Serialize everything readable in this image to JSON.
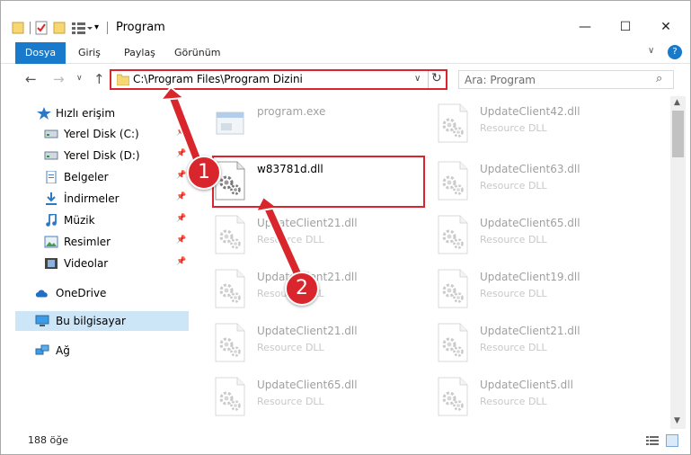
{
  "window": {
    "title": "Program",
    "minimize_glyph": "—",
    "maximize_glyph": "☐",
    "close_glyph": "✕"
  },
  "ribbon": {
    "tabs": [
      "Dosya",
      "Giriş",
      "Paylaş",
      "Görünüm"
    ],
    "active_tab": "Dosya",
    "help_glyph": "?"
  },
  "address": {
    "path": "C:\\Program Files\\Program Dizini",
    "search_placeholder": "Ara: Program"
  },
  "nav_pane": {
    "quick_access": "Hızlı erişim",
    "quick_items": [
      {
        "label": "Yerel Disk (C:)",
        "icon": "drive-icon",
        "pinned": true
      },
      {
        "label": "Yerel Disk (D:)",
        "icon": "drive-icon",
        "pinned": true
      },
      {
        "label": "Belgeler",
        "icon": "documents-icon",
        "pinned": true
      },
      {
        "label": "İndirmeler",
        "icon": "downloads-icon",
        "pinned": true
      },
      {
        "label": "Müzik",
        "icon": "music-icon",
        "pinned": true
      },
      {
        "label": "Resimler",
        "icon": "pictures-icon",
        "pinned": true
      },
      {
        "label": "Videolar",
        "icon": "videos-icon",
        "pinned": true
      }
    ],
    "onedrive": "OneDrive",
    "this_pc": "Bu bilgisayar",
    "network": "Ağ"
  },
  "files": {
    "left_column": [
      {
        "name": "program.exe",
        "type": "",
        "faded": true,
        "highlighted": false,
        "icon": "exe-icon"
      },
      {
        "name": "w83781d.dll",
        "type": "",
        "faded": false,
        "highlighted": true,
        "icon": "dll-gear-icon"
      },
      {
        "name": "UpdateClient21.dll",
        "type": "Resource DLL",
        "faded": true,
        "highlighted": false,
        "icon": "dll-gear-icon"
      },
      {
        "name": "UpdateClient21.dll",
        "type": "Resource DLL",
        "faded": true,
        "highlighted": false,
        "icon": "dll-gear-icon"
      },
      {
        "name": "UpdateClient21.dll",
        "type": "Resource DLL",
        "faded": true,
        "highlighted": false,
        "icon": "dll-gear-icon"
      },
      {
        "name": "UpdateClient65.dll",
        "type": "Resource DLL",
        "faded": true,
        "highlighted": false,
        "icon": "dll-gear-icon"
      }
    ],
    "right_column": [
      {
        "name": "UpdateClient42.dll",
        "type": "Resource DLL",
        "faded": true,
        "icon": "dll-gear-icon"
      },
      {
        "name": "UpdateClient63.dll",
        "type": "Resource DLL",
        "faded": true,
        "icon": "dll-gear-icon"
      },
      {
        "name": "UpdateClient65.dll",
        "type": "Resource DLL",
        "faded": true,
        "icon": "dll-gear-icon"
      },
      {
        "name": "UpdateClient19.dll",
        "type": "Resource DLL",
        "faded": true,
        "icon": "dll-gear-icon"
      },
      {
        "name": "UpdateClient21.dll",
        "type": "Resource DLL",
        "faded": true,
        "icon": "dll-gear-icon"
      },
      {
        "name": "UpdateClient5.dll",
        "type": "Resource DLL",
        "faded": true,
        "icon": "dll-gear-icon"
      }
    ]
  },
  "status": {
    "item_count": "188 öğe"
  },
  "annotations": {
    "badge_1": "1",
    "badge_2": "2",
    "color": "#d9262c"
  },
  "colors": {
    "accent": "#1979ca",
    "selection": "#cde6f7",
    "annotation_red": "#d9262c"
  }
}
